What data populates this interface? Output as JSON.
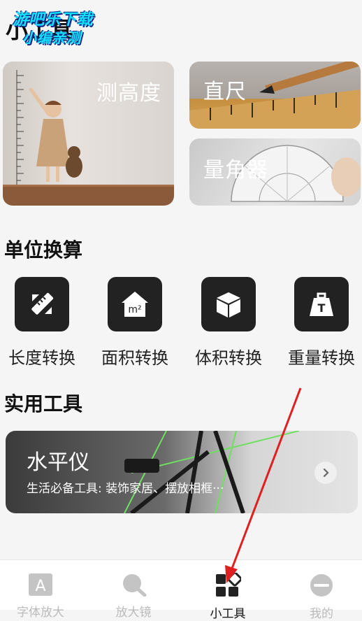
{
  "header": {
    "title": "小工具"
  },
  "watermark": {
    "line1": "游吧乐下载",
    "line2": "小编亲测"
  },
  "feature_cards": {
    "height": {
      "label": "测高度"
    },
    "ruler": {
      "label": "直尺"
    },
    "protractor": {
      "label": "量角器"
    }
  },
  "unit_section": {
    "title": "单位换算",
    "items": [
      {
        "label": "长度转换",
        "icon": "ruler-pencil-icon"
      },
      {
        "label": "面积转换",
        "icon": "house-m2-icon"
      },
      {
        "label": "体积转换",
        "icon": "cube-icon"
      },
      {
        "label": "重量转换",
        "icon": "weight-t-icon"
      }
    ]
  },
  "tools_section": {
    "title": "实用工具",
    "banner": {
      "title": "水平仪",
      "subtitle": "生活必备工具: 装饰家居、摆放相框···"
    }
  },
  "tabbar": {
    "items": [
      {
        "label": "字体放大",
        "icon": "font-a-icon",
        "active": false
      },
      {
        "label": "放大镜",
        "icon": "magnifier-icon",
        "active": false
      },
      {
        "label": "小工具",
        "icon": "grid-tools-icon",
        "active": true
      },
      {
        "label": "我的",
        "icon": "profile-icon",
        "active": false
      }
    ]
  },
  "colors": {
    "accent_arrow": "#e02020",
    "icon_bg": "#222222",
    "tab_inactive": "#bbbbbb"
  }
}
